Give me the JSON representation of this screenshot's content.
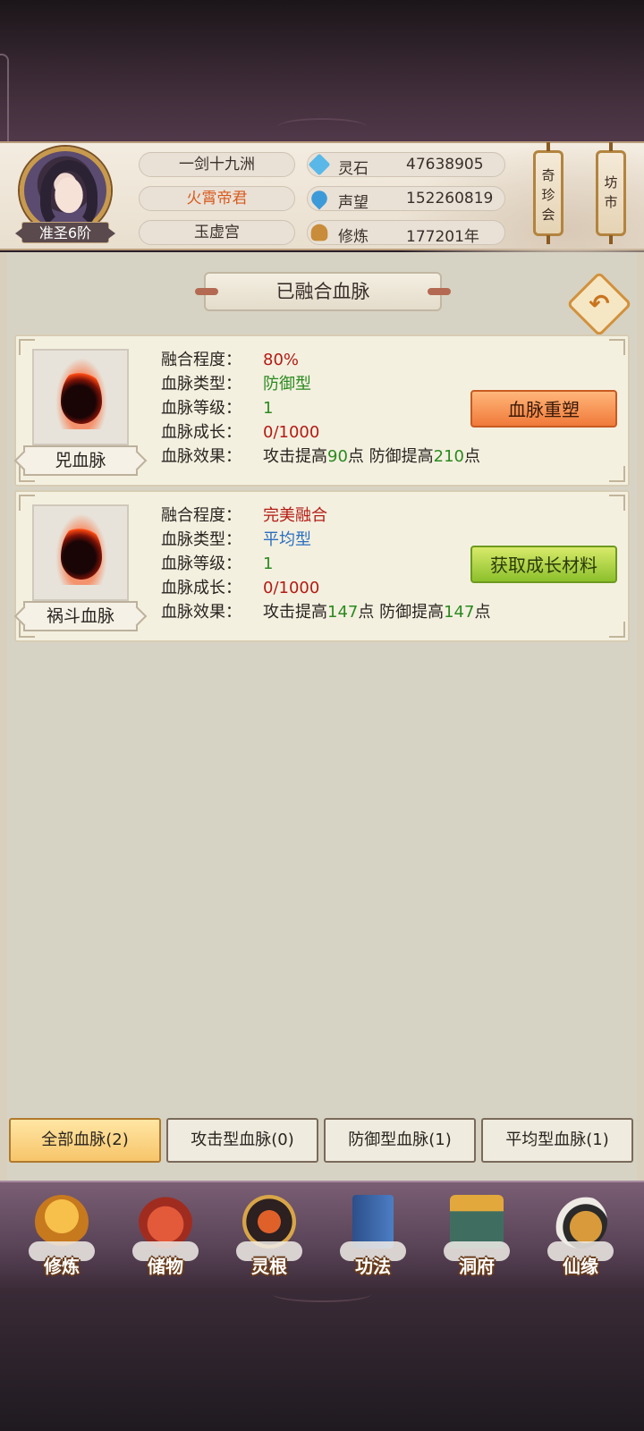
{
  "player": {
    "rank": "准圣6阶",
    "names": [
      "一剑十九洲",
      "火霄帝君",
      "玉虚宫"
    ]
  },
  "stats": [
    {
      "icon": "spirit-stone-icon",
      "label": "灵石",
      "value": "47638905"
    },
    {
      "icon": "reputation-icon",
      "label": "声望",
      "value": "152260819"
    },
    {
      "icon": "cultivation-icon",
      "label": "修炼",
      "value": "177201年"
    }
  ],
  "side_buttons": {
    "treasure": "奇珍会",
    "market": "坊市"
  },
  "panel": {
    "title": "已融合血脉",
    "back_glyph": "↶"
  },
  "labels": {
    "fusion": "融合程度：",
    "type": "血脉类型：",
    "level": "血脉等级：",
    "growth": "血脉成长：",
    "effect": "血脉效果："
  },
  "bloodlines": [
    {
      "name": "兕血脉",
      "fusion": "80%",
      "type": "防御型",
      "level": "1",
      "growth": "0/1000",
      "effect_parts": [
        "攻击提高",
        "90",
        "点 防御提高",
        "210",
        "点"
      ],
      "action": "血脉重塑"
    },
    {
      "name": "祸斗血脉",
      "fusion": "完美融合",
      "type": "平均型",
      "level": "1",
      "growth": "0/1000",
      "effect_parts": [
        "攻击提高",
        "147",
        "点 防御提高",
        "147",
        "点"
      ],
      "action": "获取成长材料"
    }
  ],
  "tabs": [
    "全部血脉(2)",
    "攻击型血脉(0)",
    "防御型血脉(1)",
    "平均型血脉(1)"
  ],
  "nav": [
    "修炼",
    "储物",
    "灵根",
    "功法",
    "洞府",
    "仙缘"
  ],
  "colors": {
    "accent_orange": "#f07a3a",
    "accent_green": "#8cc02c",
    "red_text": "#b31b14",
    "green_text": "#2a8a1f",
    "blue_text": "#2a6fc0"
  }
}
